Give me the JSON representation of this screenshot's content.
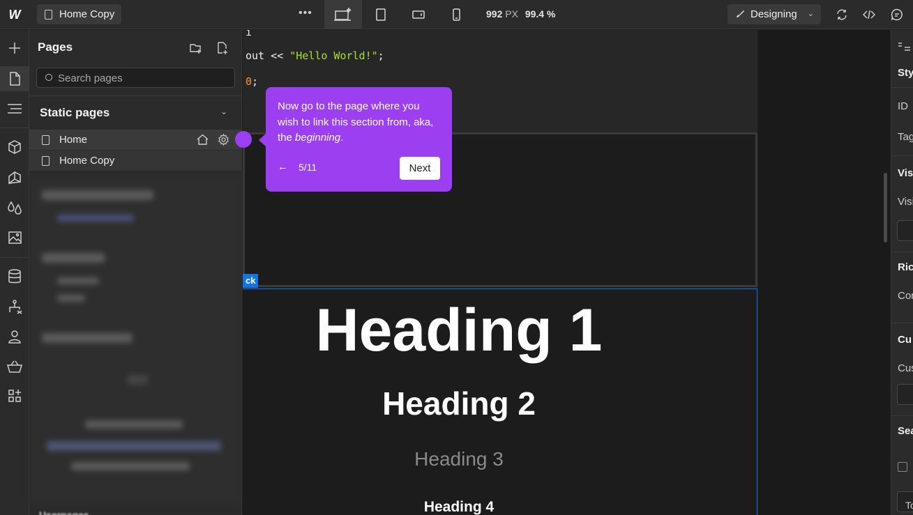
{
  "topbar": {
    "logo": "W",
    "current_page": "Home Copy",
    "more": "•••",
    "width_value": "992",
    "width_unit": "PX",
    "zoom": "99.4 %",
    "mode": "Designing"
  },
  "pages_panel": {
    "title": "Pages",
    "search_placeholder": "Search pages",
    "section_title": "Static pages",
    "pages": [
      {
        "label": "Home"
      },
      {
        "label": "Home Copy"
      }
    ],
    "bottom_label": "Userpages"
  },
  "canvas": {
    "code_lines": [
      {
        "plain": "i"
      },
      {
        "plain": "out << ",
        "string": "\"Hello World!\"",
        "tail": ";"
      },
      {
        "num": "0",
        "tail": ";"
      }
    ],
    "block_tag": "ck",
    "headings": [
      "Heading 1",
      "Heading 2",
      "Heading 3",
      "Heading 4"
    ]
  },
  "tooltip": {
    "text_start": "Now go to the page where you wish to link this section from, aka, the ",
    "text_em": "beginning",
    "text_end": ".",
    "back": "←",
    "step": "5/11",
    "next_label": "Next"
  },
  "right_panel": {
    "items": [
      "Sty",
      "ID",
      "Tag",
      "Vis",
      "Visi",
      "Ric",
      "Cor",
      "Cu",
      "Cus",
      "Sea",
      "To"
    ]
  },
  "colors": {
    "accent": "#9b3ff0",
    "selection": "#1473e6",
    "code_string": "#a6e22e",
    "code_number": "#fd971f"
  }
}
